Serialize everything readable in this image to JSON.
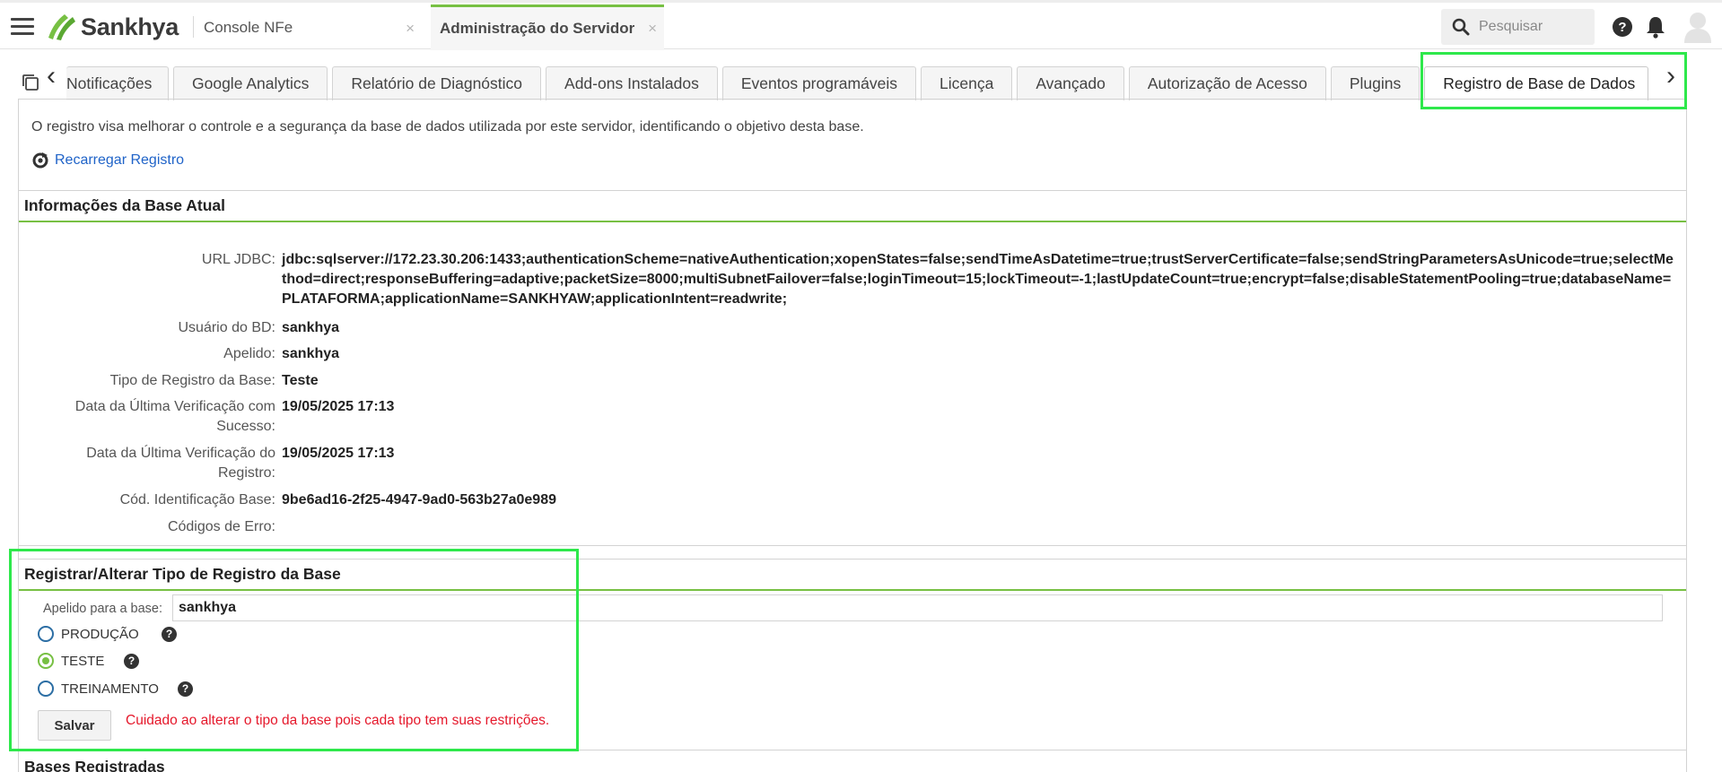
{
  "app": {
    "brand": "Sankhya",
    "colors": {
      "accent": "#77c043",
      "link": "#1f63c8",
      "warning": "#e5182b",
      "highlight": "#2ee84b"
    }
  },
  "header": {
    "menu_icon": "hamburger-menu-icon",
    "app_tabs": [
      {
        "label": "Console NFe",
        "close": "×"
      },
      {
        "label": "Administração do Servidor",
        "close": "×"
      }
    ],
    "search": {
      "placeholder": "Pesquisar",
      "icon": "search-icon"
    },
    "icons": [
      "help-icon",
      "bell-icon",
      "user-avatar-icon"
    ]
  },
  "tabs": {
    "items": [
      "Notificações",
      "Google Analytics",
      "Relatório de Diagnóstico",
      "Add-ons Instalados",
      "Eventos programáveis",
      "Licença",
      "Avançado",
      "Autorização de Acesso",
      "Plugins",
      "Registro de Base de Dados"
    ],
    "active": "Registro de Base de Dados",
    "prev_arrow": "‹",
    "next_arrow": "›"
  },
  "content": {
    "intro": "O registro visa melhorar o controle e a segurança da base de dados utilizada por este servidor, identificando o objetivo desta base.",
    "reload_label": "Recarregar Registro",
    "current_section": {
      "title": "Informações da Base Atual",
      "fields": [
        {
          "label": "URL JDBC:",
          "value": "jdbc:sqlserver://172.23.30.206:1433;authenticationScheme=nativeAuthentication;xopenStates=false;sendTimeAsDatetime=true;trustServerCertificate=false;sendStringParametersAsUnicode=true;selectMethod=direct;responseBuffering=adaptive;packetSize=8000;multiSubnetFailover=false;loginTimeout=15;lockTimeout=-1;lastUpdateCount=true;encrypt=false;disableStatementPooling=true;databaseName=PLATAFORMA;applicationName=SANKHYAW;applicationIntent=readwrite;"
        },
        {
          "label": "Usuário do BD:",
          "value": "sankhya"
        },
        {
          "label": "Apelido:",
          "value": "sankhya"
        },
        {
          "label": "Tipo de Registro da Base:",
          "value": "Teste"
        },
        {
          "label": "Data da Última Verificação com Sucesso:",
          "value": "19/05/2025 17:13"
        },
        {
          "label": "Data da Última Verificação do Registro:",
          "value": "19/05/2025 17:13"
        },
        {
          "label": "Cód. Identificação Base:",
          "value": "9be6ad16-2f25-4947-9ad0-563b27a0e989"
        },
        {
          "label": "Códigos de Erro:",
          "value": ""
        }
      ]
    },
    "register_section": {
      "title": "Registrar/Alterar Tipo de Registro da Base",
      "alias_label": "Apelido para a base:",
      "alias_value": "sankhya",
      "options": [
        {
          "label": "PRODUÇÃO",
          "checked": false
        },
        {
          "label": "TESTE",
          "checked": true
        },
        {
          "label": "TREINAMENTO",
          "checked": false
        }
      ],
      "help_glyph": "?",
      "save_label": "Salvar",
      "warning": "Cuidado ao alterar o tipo da base pois cada tipo tem suas restrições."
    },
    "registered_section": {
      "title": "Bases Registradas"
    }
  }
}
